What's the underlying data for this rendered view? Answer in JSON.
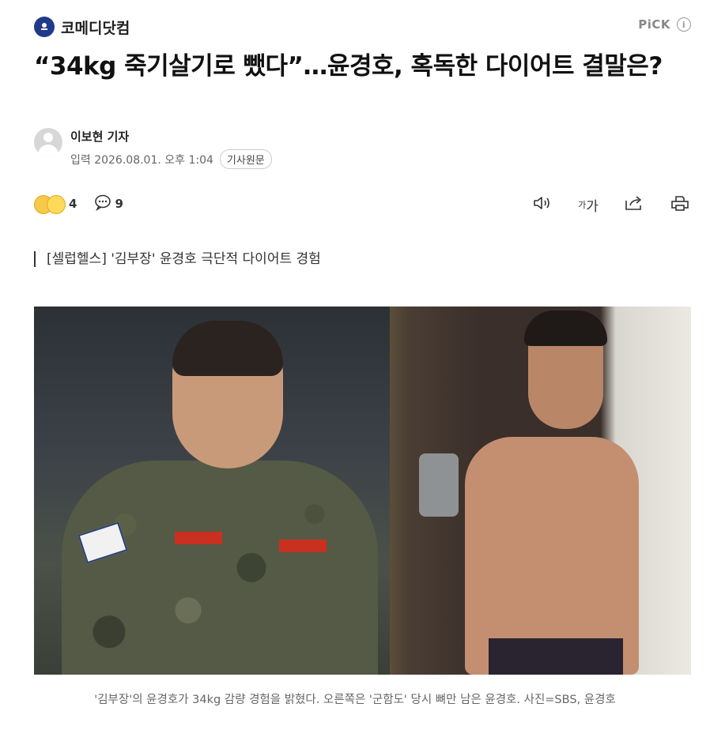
{
  "press": {
    "name": "코메디닷컴",
    "logo_icon": "comedy-dotcom-logo"
  },
  "pick": {
    "label": "PiCK",
    "info_symbol": "i"
  },
  "article": {
    "title": "“34kg 죽기살기로 뺐다”…윤경호, 혹독한 다이어트 결말은?",
    "reporter": "이보현 기자",
    "date": "입력 2026.08.01. 오후 1:04",
    "original_button": "기사원문",
    "subhead": "[셀럽헬스] '김부장' 윤경호 극단적 다이어트 경험",
    "caption": "'김부장'의 윤경호가 34kg 감량 경험을 밝혔다. 오른쪽은 '군함도' 당시 뼈만 남은 윤경호. 사진=SBS, 윤경호"
  },
  "toolbar": {
    "reaction_count": "4",
    "comment_count": "9",
    "font_label_small": "가",
    "font_label_large": "가"
  },
  "colors": {
    "accent": "#1f3a8a",
    "text": "#111111",
    "muted": "#666666"
  }
}
